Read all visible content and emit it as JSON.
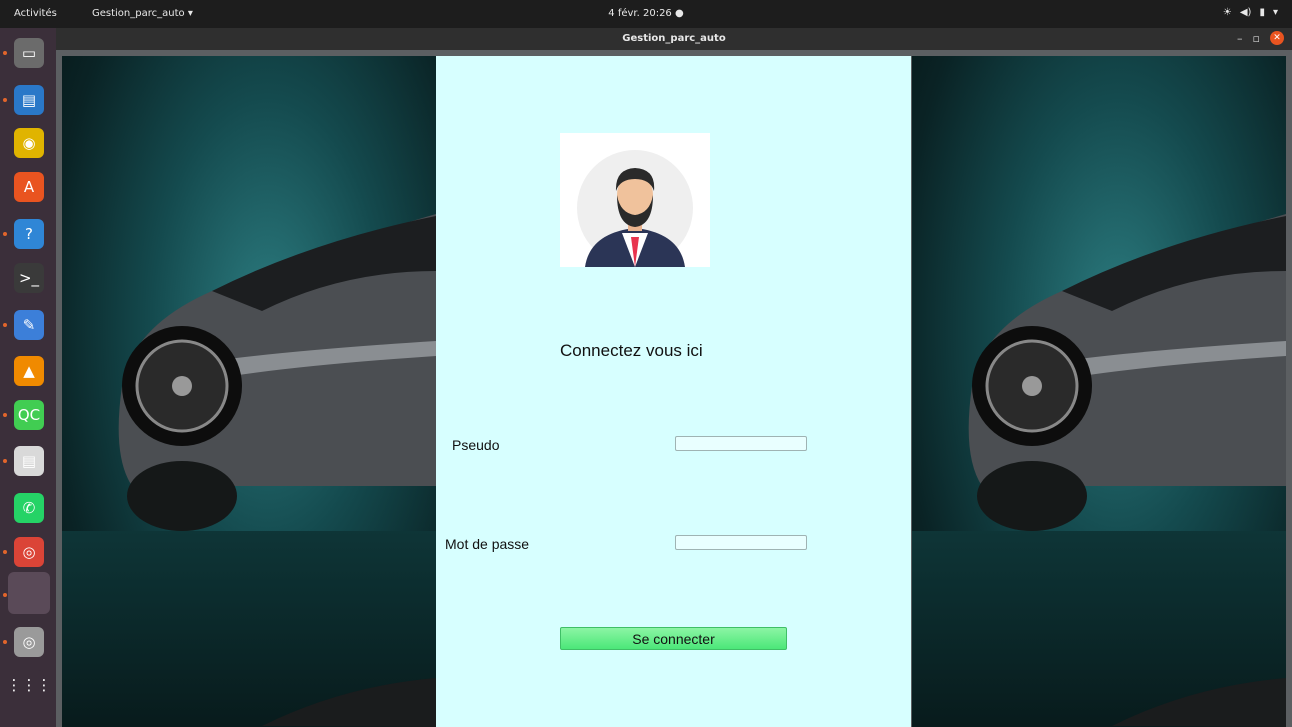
{
  "topbar": {
    "activities": "Activités",
    "app_menu": "Gestion_parc_auto ▾",
    "clock": "4 févr.  20:26  ●",
    "tray": [
      "☀",
      "◀)",
      "▮",
      "▾"
    ]
  },
  "window": {
    "title": "Gestion_parc_auto",
    "minimize": "–",
    "restore": "▫",
    "close": "✕"
  },
  "login": {
    "heading": "Connectez vous ici",
    "pseudo_label": "Pseudo",
    "pseudo_value": "",
    "password_label": "Mot de passe",
    "password_value": "",
    "submit_label": "Se connecter"
  },
  "dock": {
    "apps": [
      {
        "icon": "files-icon",
        "color": "#6b6b6b",
        "glyph": "▭"
      },
      {
        "icon": "writer-icon",
        "color": "#2a78c8",
        "glyph": "▤"
      },
      {
        "icon": "rhythmbox-icon",
        "color": "#e0b400",
        "glyph": "◉"
      },
      {
        "icon": "software-icon",
        "color": "#e95420",
        "glyph": "A"
      },
      {
        "icon": "help-icon",
        "color": "#2f86d6",
        "glyph": "?"
      },
      {
        "icon": "terminal-icon",
        "color": "#3a3a3a",
        "glyph": ">_"
      },
      {
        "icon": "text-editor-icon",
        "color": "#3c7fd9",
        "glyph": "✎"
      },
      {
        "icon": "vlc-icon",
        "color": "#f08a00",
        "glyph": "▲"
      },
      {
        "icon": "qt-creator-icon",
        "color": "#41cd52",
        "glyph": "QC"
      },
      {
        "icon": "document-viewer-icon",
        "color": "#d9d9d9",
        "glyph": "▤"
      },
      {
        "icon": "whatsapp-icon",
        "color": "#25d366",
        "glyph": "✆"
      },
      {
        "icon": "chrome-icon",
        "color": "#db4437",
        "glyph": "◎"
      },
      {
        "icon": "active-window-icon",
        "color": "#5a4a58",
        "glyph": ""
      },
      {
        "icon": "disk-icon",
        "color": "#9a9a9a",
        "glyph": "◎"
      },
      {
        "icon": "app-grid-icon",
        "color": "#3b2f3a",
        "glyph": "⋮⋮⋮"
      }
    ]
  }
}
